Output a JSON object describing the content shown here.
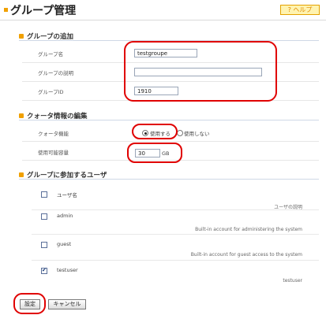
{
  "header": {
    "title": "グループ管理",
    "help_label": "? ヘルプ"
  },
  "add_group": {
    "section_title": "グループの追加",
    "name_label": "グループ名",
    "name_value": "testgroupe",
    "description_label": "グループの説明",
    "description_value": "",
    "id_label": "グループID",
    "id_value": "1910"
  },
  "quota": {
    "section_title": "クォータ情報の編集",
    "function_label": "クォータ機能",
    "use_label": "使用する",
    "no_use_label": "使用しない",
    "selected": "使用する",
    "capacity_label": "使用可能容量",
    "capacity_value": "30",
    "unit": "GB"
  },
  "members": {
    "section_title": "グループに参加するユーザ",
    "col_user_name": "ユーザ名",
    "col_description": "ユーザの説明",
    "users": [
      {
        "name": "admin",
        "description": "Built-in account for administering the system",
        "checked": false
      },
      {
        "name": "guest",
        "description": "Built-in account for guest access to the system",
        "checked": false
      },
      {
        "name": "testuser",
        "description": "testuser",
        "checked": true
      }
    ]
  },
  "actions": {
    "save_label": "設定",
    "cancel_label": "キャンセル"
  },
  "colors": {
    "highlight": "#e00000",
    "accent": "#f0a000"
  }
}
